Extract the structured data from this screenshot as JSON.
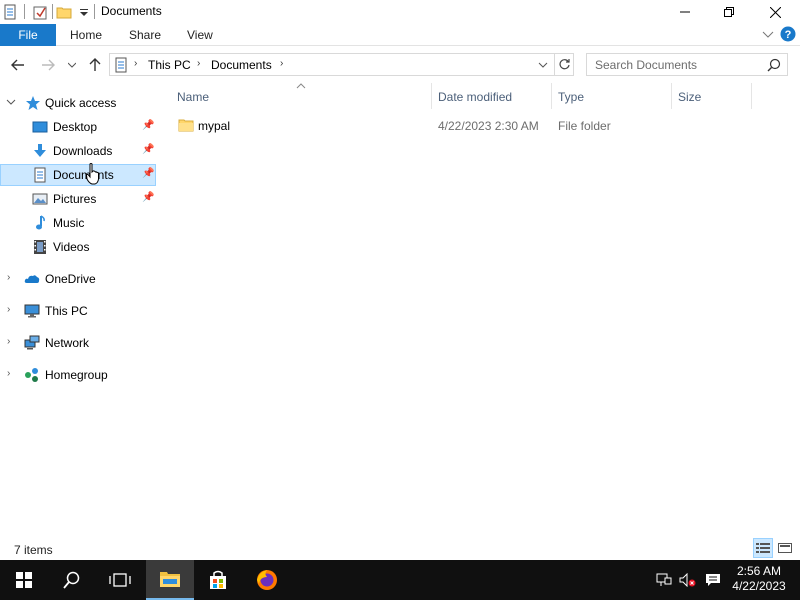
{
  "window": {
    "title": "Documents"
  },
  "ribbon": {
    "file": "File",
    "tabs": [
      "Home",
      "Share",
      "View"
    ]
  },
  "address": {
    "crumbs": [
      "This PC",
      "Documents"
    ]
  },
  "search": {
    "placeholder": "Search Documents"
  },
  "sidebar": {
    "quick_access": "Quick access",
    "quick_items": [
      {
        "label": "Desktop",
        "pinned": true
      },
      {
        "label": "Downloads",
        "pinned": true
      },
      {
        "label": "Documents",
        "pinned": true,
        "selected": true
      },
      {
        "label": "Pictures",
        "pinned": true
      },
      {
        "label": "Music",
        "pinned": false
      },
      {
        "label": "Videos",
        "pinned": false
      }
    ],
    "roots": [
      "OneDrive",
      "This PC",
      "Network",
      "Homegroup"
    ]
  },
  "columns": [
    "Name",
    "Date modified",
    "Type",
    "Size"
  ],
  "files": [
    {
      "name": "mypal",
      "date": "4/22/2023 2:30 AM",
      "type": "File folder",
      "size": ""
    }
  ],
  "status": {
    "count": "7 items"
  },
  "taskbar": {
    "time": "2:56 AM",
    "date": "4/22/2023"
  },
  "colors": {
    "accent": "#1979ca",
    "selected_bg": "#cce8ff",
    "taskbar": "#101010"
  }
}
